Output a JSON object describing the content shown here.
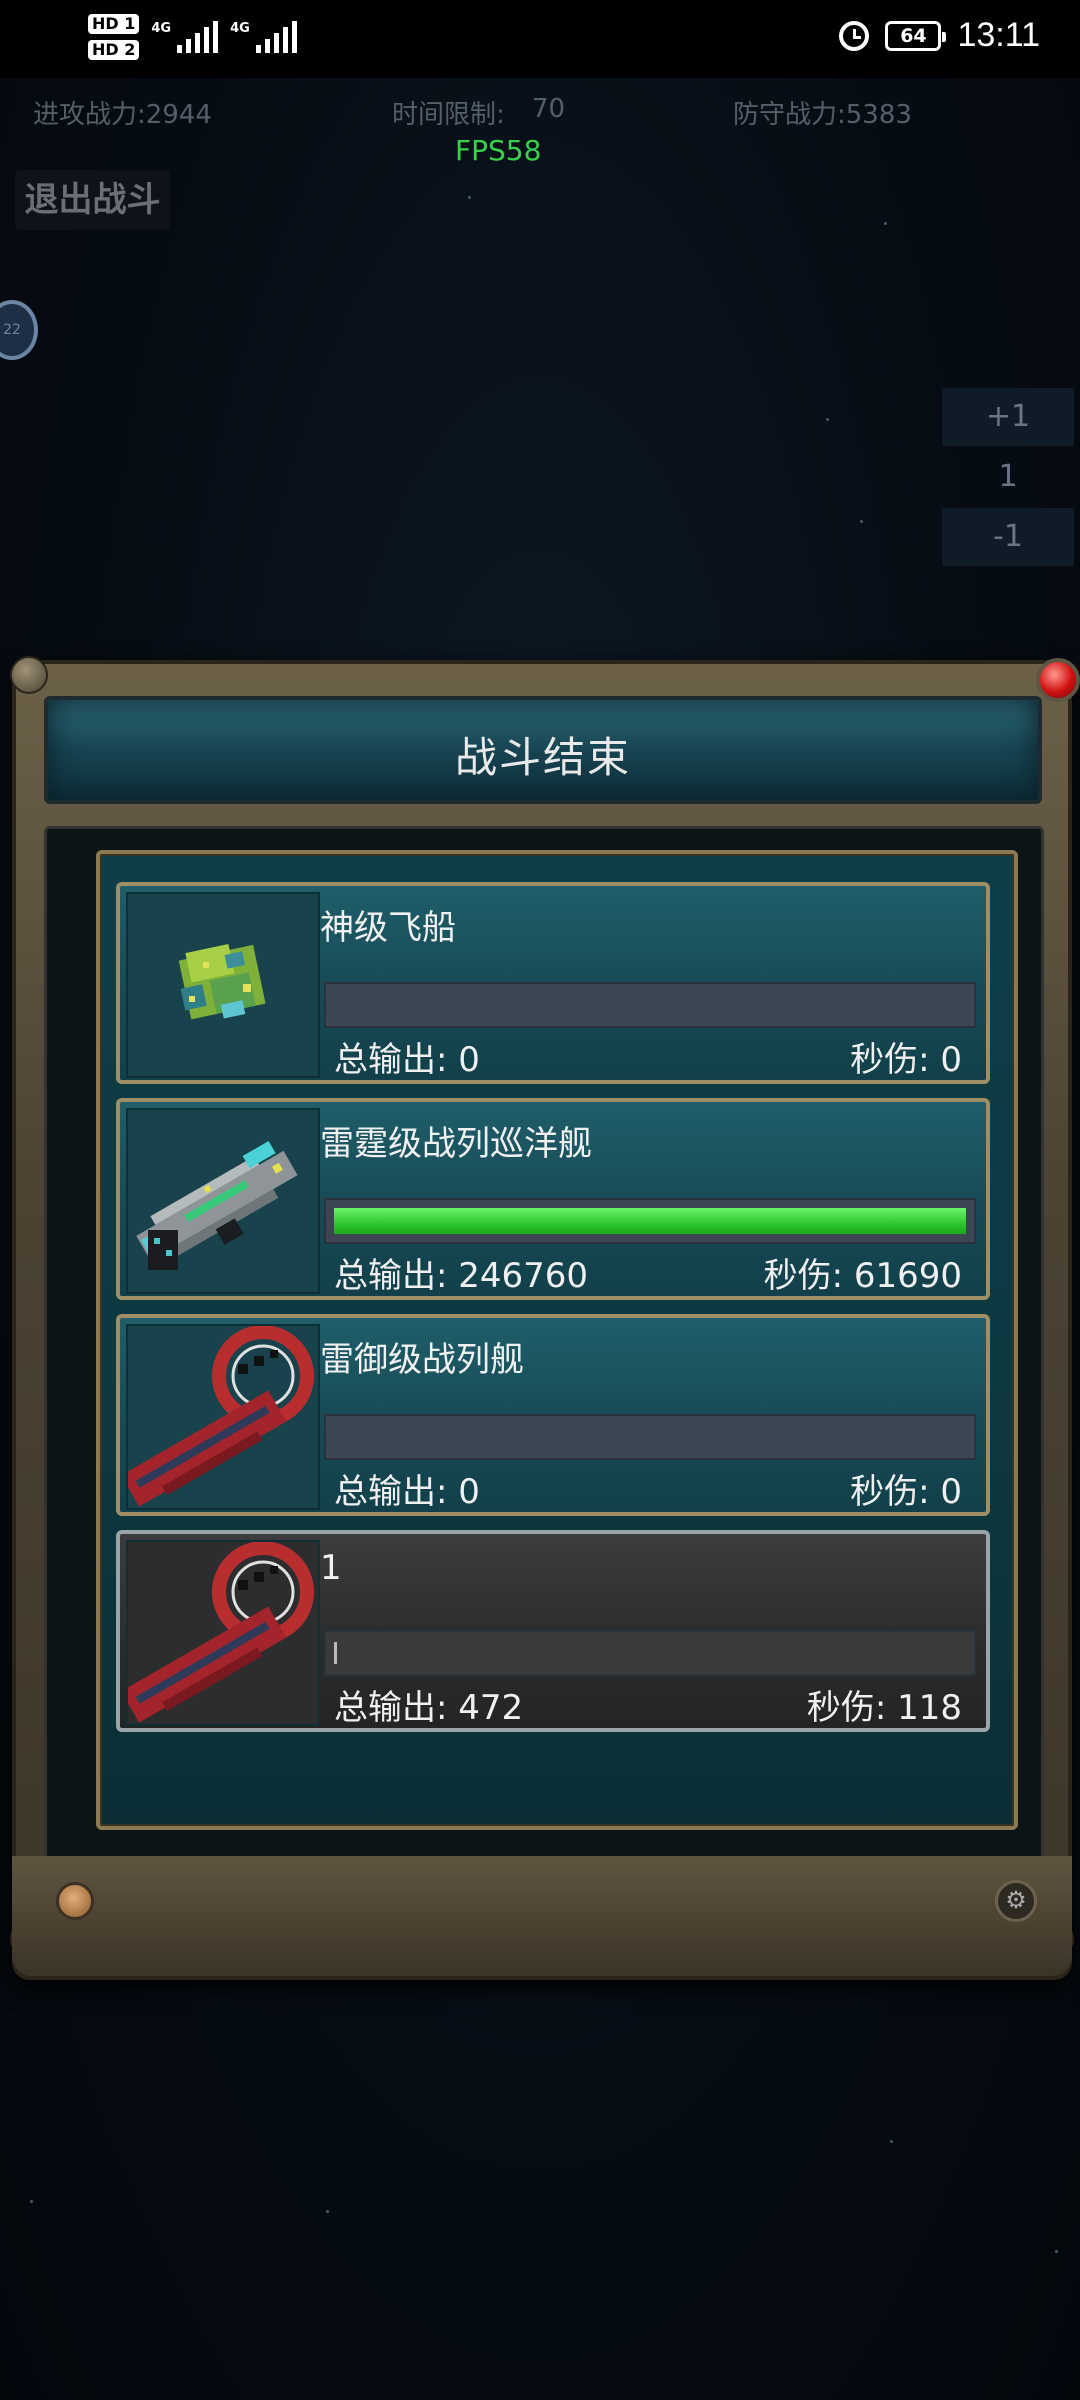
{
  "status_bar": {
    "sim1": "HD 1",
    "sim2": "HD 2",
    "network1": "4G",
    "network2": "4G",
    "battery": "64",
    "time": "13:11"
  },
  "hud": {
    "attack_power": "进攻战力:2944",
    "time_limit_label": "时间限制:",
    "time_limit_value": "70",
    "defense_power": "防守战力:5383",
    "fps": "FPS58",
    "exit_button": "退出战斗",
    "side_badge": "22",
    "speed_plus": "+1",
    "speed_value": "1",
    "speed_minus": "-1"
  },
  "dialog": {
    "title": "战斗结束",
    "stat_output_label": "总输出: ",
    "stat_dps_label": "秒伤: ",
    "rows": [
      {
        "name": "神级飞船",
        "output": "总输出: 0",
        "dps": "秒伤: 0",
        "progress": 0,
        "icon": "green-cube-ship-icon"
      },
      {
        "name": "雷霆级战列巡洋舰",
        "output": "总输出: 246760",
        "dps": "秒伤: 61690",
        "progress": 1.0,
        "icon": "grey-cruiser-ship-icon"
      },
      {
        "name": "雷御级战列舰",
        "output": "总输出: 0",
        "dps": "秒伤: 0",
        "progress": 0,
        "icon": "red-battleship-icon"
      },
      {
        "name": "1",
        "output": "总输出: 472",
        "dps": "秒伤: 118",
        "progress": 0.002,
        "icon": "red-battleship-icon"
      }
    ]
  },
  "colors": {
    "fps": "#39d14a",
    "progress_fill": "#2dc72d",
    "frame_gold": "#a08f66",
    "panel_teal": "#174a55"
  }
}
